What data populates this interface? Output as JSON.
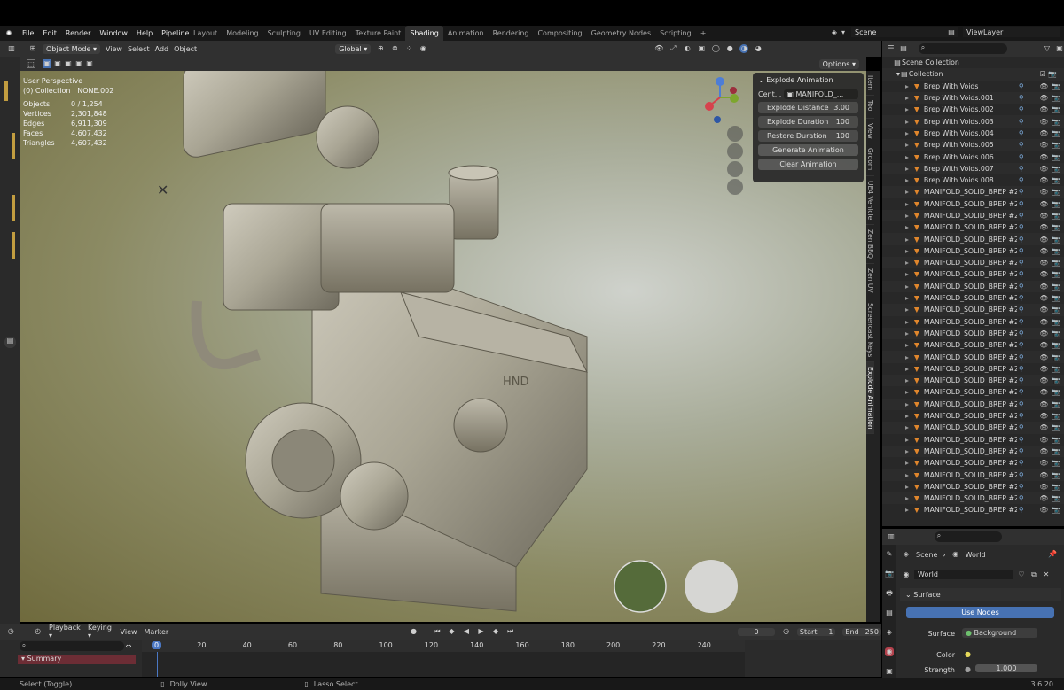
{
  "menu": [
    "File",
    "Edit",
    "Render",
    "Window",
    "Help",
    "Pipeline"
  ],
  "workspaces": [
    "Layout",
    "Modeling",
    "Sculpting",
    "UV Editing",
    "Texture Paint",
    "Shading",
    "Animation",
    "Rendering",
    "Compositing",
    "Geometry Nodes",
    "Scripting"
  ],
  "active_workspace": "Shading",
  "scene": "Scene",
  "view_layer": "ViewLayer",
  "viewport_header": {
    "mode": "Object Mode",
    "view": "View",
    "select": "Select",
    "add": "Add",
    "object": "Object",
    "orientation": "Global",
    "options": "Options"
  },
  "overlay": {
    "perspective": "User Perspective",
    "collection": "(0) Collection | NONE.002",
    "stats": [
      {
        "label": "Objects",
        "value": "0 / 1,254"
      },
      {
        "label": "Vertices",
        "value": "2,301,848"
      },
      {
        "label": "Edges",
        "value": "6,911,309"
      },
      {
        "label": "Faces",
        "value": "4,607,432"
      },
      {
        "label": "Triangles",
        "value": "4,607,432"
      }
    ]
  },
  "explode_panel": {
    "title": "Explode Animation",
    "center_label": "Cent...",
    "center_value": "MANIFOLD_...",
    "rows": [
      {
        "label": "Explode Distance",
        "value": "3.00"
      },
      {
        "label": "Explode Duration",
        "value": "100"
      },
      {
        "label": "Restore Duration",
        "value": "100"
      }
    ],
    "generate": "Generate Animation",
    "clear": "Clear Animation"
  },
  "sidebar_tabs": [
    "Item",
    "Tool",
    "View",
    "Groom",
    "UE4 Vehicle",
    "Zen BBQ",
    "Zen UV",
    "Screencast Keys",
    "Explode Animation"
  ],
  "outliner": {
    "root": "Scene Collection",
    "collection": "Collection",
    "items": [
      "Brep With Voids",
      "Brep With Voids.001",
      "Brep With Voids.002",
      "Brep With Voids.003",
      "Brep With Voids.004",
      "Brep With Voids.005",
      "Brep With Voids.006",
      "Brep With Voids.007",
      "Brep With Voids.008",
      "MANIFOLD_SOLID_BREP #218",
      "MANIFOLD_SOLID_BREP #218",
      "MANIFOLD_SOLID_BREP #218",
      "MANIFOLD_SOLID_BREP #218",
      "MANIFOLD_SOLID_BREP #218",
      "MANIFOLD_SOLID_BREP #218",
      "MANIFOLD_SOLID_BREP #221",
      "MANIFOLD_SOLID_BREP #221",
      "MANIFOLD_SOLID_BREP #221",
      "MANIFOLD_SOLID_BREP #222",
      "MANIFOLD_SOLID_BREP #222",
      "MANIFOLD_SOLID_BREP #222",
      "MANIFOLD_SOLID_BREP #222",
      "MANIFOLD_SOLID_BREP #222",
      "MANIFOLD_SOLID_BREP #222",
      "MANIFOLD_SOLID_BREP #222",
      "MANIFOLD_SOLID_BREP #222",
      "MANIFOLD_SOLID_BREP #222",
      "MANIFOLD_SOLID_BREP #222",
      "MANIFOLD_SOLID_BREP #222",
      "MANIFOLD_SOLID_BREP #222",
      "MANIFOLD_SOLID_BREP #222",
      "MANIFOLD_SOLID_BREP #222",
      "MANIFOLD_SOLID_BREP #222",
      "MANIFOLD_SOLID_BREP #223",
      "MANIFOLD_SOLID_BREP #223",
      "MANIFOLD_SOLID_BREP #223",
      "MANIFOLD_SOLID_BREP #230"
    ]
  },
  "properties": {
    "breadcrumb_scene": "Scene",
    "breadcrumb_world": "World",
    "world_name": "World",
    "section": "Surface",
    "use_nodes": "Use Nodes",
    "surface_label": "Surface",
    "surface_value": "Background",
    "color_label": "Color",
    "strength_label": "Strength",
    "strength_value": "1.000"
  },
  "timeline": {
    "playback": "Playback",
    "keying": "Keying",
    "view": "View",
    "marker": "Marker",
    "current_frame": "0",
    "start_label": "Start",
    "start": "1",
    "end_label": "End",
    "end": "250",
    "summary": "Summary",
    "ticks": [
      "0",
      "20",
      "40",
      "60",
      "80",
      "100",
      "120",
      "140",
      "160",
      "180",
      "200",
      "220",
      "240"
    ]
  },
  "status": {
    "select": "Select (Toggle)",
    "dolly": "Dolly View",
    "lasso": "Lasso Select",
    "version": "3.6.20"
  },
  "colors": {
    "accent": "#4772b3",
    "object_orange": "#e0862c",
    "timeline_current": "#4b78c4"
  }
}
